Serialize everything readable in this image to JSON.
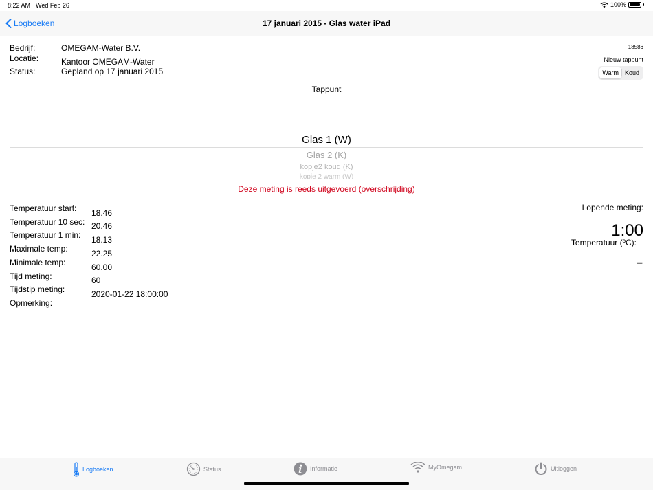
{
  "status_bar": {
    "time": "8:22 AM",
    "date": "Wed Feb 26",
    "battery": "100%",
    "battery_level": 1.0
  },
  "nav": {
    "back_label": "Logboeken",
    "title": "17 januari 2015 - Glas water iPad"
  },
  "info": {
    "company_label": "Bedrijf:",
    "company_value": "OMEGAM-Water B.V.",
    "location_label": "Locatie:",
    "location_value": "Kantoor OMEGAM-Water",
    "status_label": "Status:",
    "status_value": "Gepland op 17 januari 2015",
    "id": "18586",
    "new_tap_label": "Nieuw tappunt",
    "segment": {
      "options": [
        "Warm",
        "Koud"
      ],
      "selected": "Warm"
    }
  },
  "tappunt": {
    "label": "Tappunt",
    "options": [
      "Glas 1 (W)",
      "Glas 2 (K)",
      "kopje2 koud (K)",
      "kopje 2 warm (W)"
    ],
    "selected": "Glas 1 (W)"
  },
  "warning": "Deze meting is reeds uitgevoerd (overschrijding)",
  "measurements": {
    "labels": [
      "Temperatuur start:",
      "Temperatuur 10 sec:",
      "Temperatuur 1 min:",
      "Maximale temp:",
      "Minimale temp:",
      "Tijd meting:",
      "Tijdstip meting:",
      "Opmerking:"
    ],
    "values": [
      "18.46",
      "20.46",
      "18.13",
      "22.25",
      "60.00",
      "60",
      "2020-01-22 18:00:00"
    ]
  },
  "running": {
    "label": "Lopende meting:",
    "timer": "1:00",
    "temp_label": "Temperatuur (ºC):",
    "temp_value": "–"
  },
  "tabs": [
    {
      "label": "Logboeken",
      "icon": "thermometer-icon",
      "active": true
    },
    {
      "label": "Status",
      "icon": "gauge-icon",
      "active": false
    },
    {
      "label": "Informatie",
      "icon": "info-icon",
      "active": false
    },
    {
      "label": "MyOmegam",
      "icon": "wifi-icon",
      "active": false
    },
    {
      "label": "Uitloggen",
      "icon": "power-icon",
      "active": false
    }
  ],
  "colors": {
    "accent": "#1a7cf5",
    "warning": "#d0021b",
    "inactive": "#8e8e93"
  }
}
